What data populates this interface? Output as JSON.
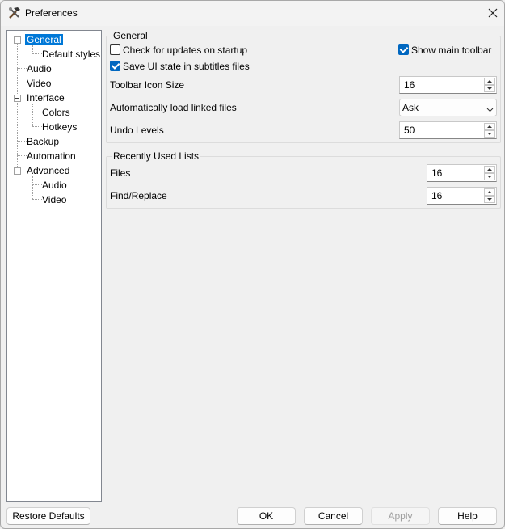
{
  "window": {
    "title": "Preferences",
    "icon": "tools-icon",
    "close_icon": "close-icon"
  },
  "tree": {
    "items": [
      {
        "label": "General",
        "selected": true,
        "expanded": true
      },
      {
        "label": "Default styles"
      },
      {
        "label": "Audio"
      },
      {
        "label": "Video"
      },
      {
        "label": "Interface",
        "expanded": true
      },
      {
        "label": "Colors"
      },
      {
        "label": "Hotkeys"
      },
      {
        "label": "Backup"
      },
      {
        "label": "Automation"
      },
      {
        "label": "Advanced",
        "expanded": true
      },
      {
        "label": "Audio"
      },
      {
        "label": "Video"
      }
    ]
  },
  "general": {
    "title": "General",
    "check_updates": {
      "label": "Check for updates on startup",
      "checked": false
    },
    "show_toolbar": {
      "label": "Show main toolbar",
      "checked": true
    },
    "save_ui_state": {
      "label": "Save UI state in subtitles files",
      "checked": true
    },
    "toolbar_icon_size": {
      "label": "Toolbar Icon Size",
      "value": "16"
    },
    "autoload": {
      "label": "Automatically load linked files",
      "value": "Ask"
    },
    "undo_levels": {
      "label": "Undo Levels",
      "value": "50"
    }
  },
  "recent": {
    "title": "Recently Used Lists",
    "files": {
      "label": "Files",
      "value": "16"
    },
    "find_replace": {
      "label": "Find/Replace",
      "value": "16"
    }
  },
  "buttons": {
    "restore_defaults": "Restore Defaults",
    "ok": "OK",
    "cancel": "Cancel",
    "apply": "Apply",
    "help": "Help"
  },
  "colors": {
    "accent": "#0067c0",
    "selection": "#0078d7"
  }
}
